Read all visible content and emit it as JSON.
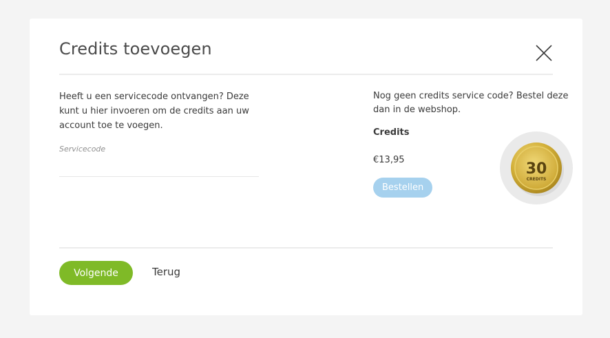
{
  "modal": {
    "title": "Credits toevoegen",
    "close_icon": "close-icon"
  },
  "left": {
    "intro": "Heeft u een servicecode ontvangen? Deze kunt u hier invoeren om de credits aan uw account toe te voegen.",
    "field_label": "Servicecode",
    "field_value": "",
    "field_placeholder": ""
  },
  "right": {
    "shop_text": "Nog geen credits service code? Bestel deze dan in de webshop.",
    "product_name": "Credits",
    "price": "€13,95",
    "order_label": "Bestellen",
    "coin": {
      "icon": "credits-coin-icon",
      "amount": "30",
      "label": "CREDITS"
    }
  },
  "footer": {
    "next_label": "Volgende",
    "back_label": "Terug"
  },
  "colors": {
    "primary_green": "#7fba27",
    "order_blue": "#a6d1ee",
    "coin_gold": "#d4b13a",
    "background": "#f4f4f4"
  }
}
